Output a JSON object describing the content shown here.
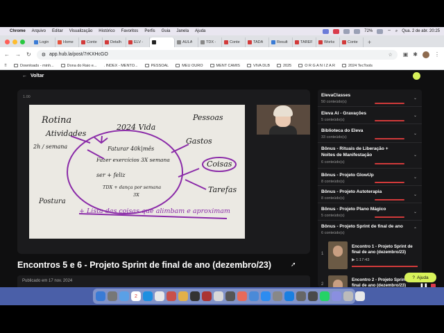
{
  "menubar": {
    "app": "Chrome",
    "items": [
      "Arquivo",
      "Editar",
      "Visualização",
      "Histórico",
      "Favoritos",
      "Perfis",
      "Guia",
      "Janela",
      "Ajuda"
    ],
    "battery": "72%",
    "datetime": "Qua. 2 de abr.  20:25"
  },
  "tabs": [
    {
      "label": "Login",
      "color": "#3a7bd5"
    },
    {
      "label": "Home",
      "color": "#e5533d"
    },
    {
      "label": "Conte",
      "color": "#d23a3a"
    },
    {
      "label": "Detalh",
      "color": "#d23a3a"
    },
    {
      "label": "ELV -",
      "color": "#d23a3a"
    },
    {
      "label": "",
      "color": "#222222",
      "active": true
    },
    {
      "label": "AULA",
      "color": "#888888"
    },
    {
      "label": "TDX -",
      "color": "#888888"
    },
    {
      "label": "Conte",
      "color": "#d23a3a"
    },
    {
      "label": "TADA",
      "color": "#d23a3a"
    },
    {
      "label": "Result",
      "color": "#3a7bd5"
    },
    {
      "label": "TAREF",
      "color": "#d23a3a"
    },
    {
      "label": "Works",
      "color": "#d23a3a"
    },
    {
      "label": "Conte",
      "color": "#d23a3a"
    }
  ],
  "address": {
    "url": "app.hub.la/post/7rKXHcGO"
  },
  "bookmarks": [
    "Downloads - minh...",
    "Dona do Raio e...",
    ". INDEX - MENTO...",
    "PESSOAL",
    "MEU OURO",
    "MENT CAMIS",
    "VIVA DLB",
    "2025",
    "O R G A N I Z A R",
    "2024 TecTools"
  ],
  "page": {
    "back_label": "Voltar",
    "video_time": "1.00",
    "title": "Encontros 5 e 6 - Projeto Sprint de final de ano (dezembro/23)",
    "published": "Publicado em 17 nov. 2024"
  },
  "whiteboard": {
    "center_line1": "Faturar 40k|mês",
    "center_line2": "Fazer exercícios 3X semana",
    "center_line3": "ser + feliz",
    "center_line4": "TDX + dança por semana",
    "center_line5": "3X",
    "year": "2024 Vida",
    "rotina": "Rotina",
    "atividades": "Atividades",
    "semana": "2h / semana",
    "postura": "Postura",
    "pessoas": "Pessoas",
    "gastos": "Gastos",
    "coisas": "Coisas",
    "tarefas": "Tarefas",
    "bottom": "+ Lista das coisas que alimbam e aproximam"
  },
  "sidebar": {
    "modules": [
      {
        "title": "ElevaClasses",
        "count": "50 conteúdo(s)"
      },
      {
        "title": "Eleva Aí - Gravações",
        "count": "5 conteúdo(s)"
      },
      {
        "title": "Biblioteca do Eleva",
        "count": "33 conteúdo(s)"
      },
      {
        "title": "Bônus - Rituais de Liberação + Noites de Manifestação",
        "count": "6 conteúdo(s)"
      },
      {
        "title": "Bônus - Projeto GlowUp",
        "count": "8 conteúdo(s)"
      },
      {
        "title": "Bônus - Projeto Autoterapia",
        "count": "8 conteúdo(s)"
      },
      {
        "title": "Bônus - Projeto Plano Mágico",
        "count": "5 conteúdo(s)"
      },
      {
        "title": "Bônus - Projeto Sprint de final de ano",
        "count": "6 conteúdo(s)"
      }
    ],
    "lessons": [
      {
        "num": "1",
        "title": "Encontro 1 - Projeto Sprint de final de ano (dezembro/23)",
        "duration": "1:17:43"
      },
      {
        "num": "2",
        "title": "Encontro 2 - Projeto Sprint de final de ano (dezembro/23)",
        "duration": ""
      }
    ]
  },
  "help": {
    "label": "Ajuda"
  },
  "dock": {
    "calendar_day": "2"
  },
  "colors": {
    "accent": "#d23a3a",
    "help": "#d7f25a",
    "bg": "#0f0f10"
  }
}
